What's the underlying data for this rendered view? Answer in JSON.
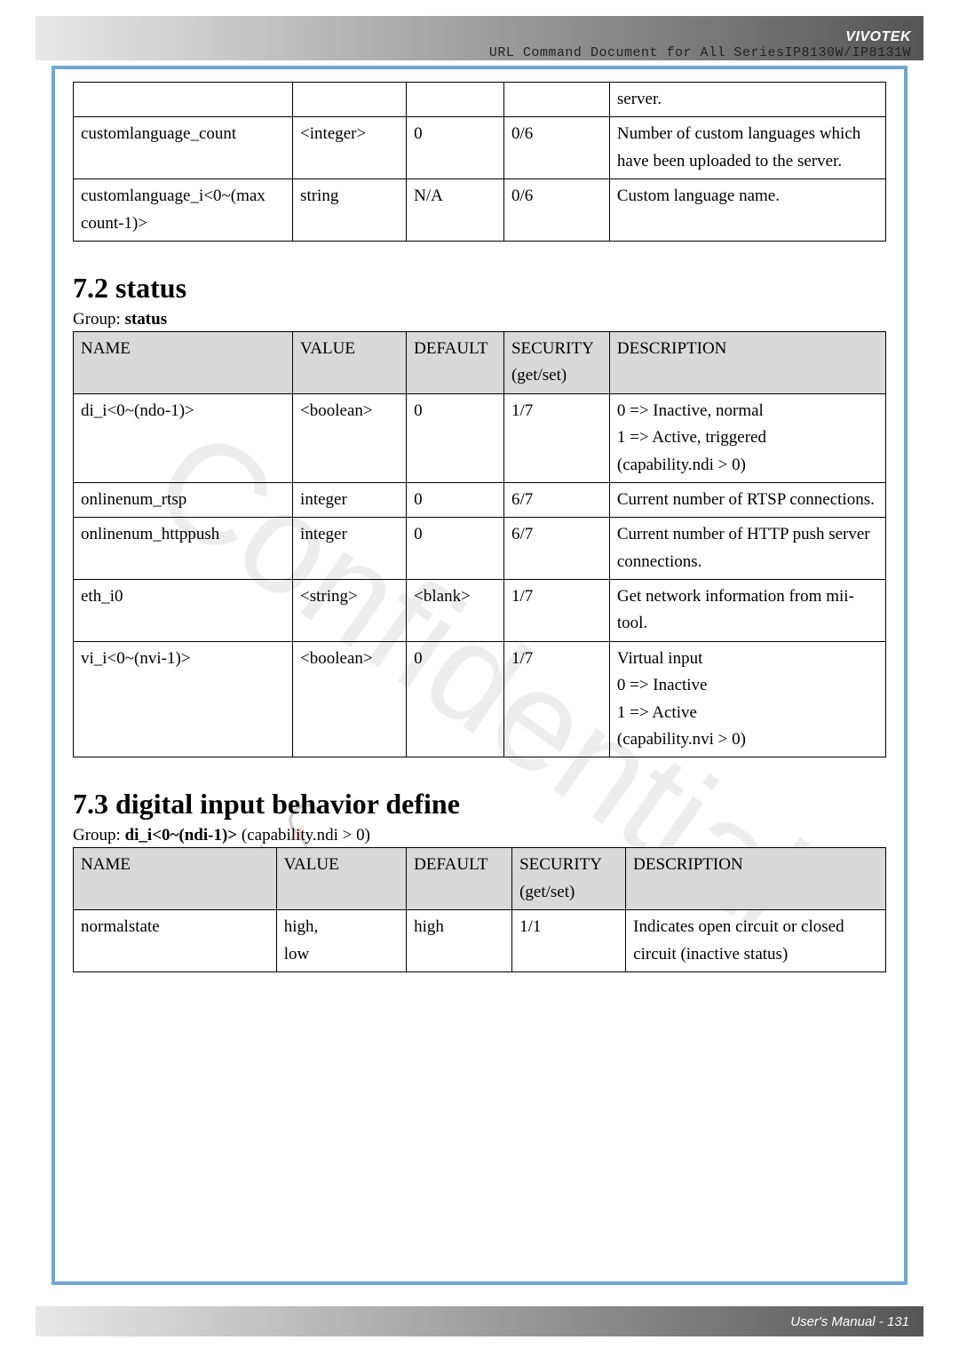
{
  "header": {
    "brand": "VIVOTEK",
    "subtitle": "URL Command Document for All SeriesIP8130W/IP8131W"
  },
  "watermark": "Confidential",
  "table1": {
    "rows": [
      {
        "name": "",
        "value": "",
        "def": "",
        "sec": "",
        "desc": "server."
      },
      {
        "name": "customlanguage_count",
        "value": "<integer>",
        "def": "0",
        "sec": "0/6",
        "desc": "Number of custom languages which have been uploaded to the server."
      },
      {
        "name": "customlanguage_i<0~(max count-1)>",
        "value": "string",
        "def": "N/A",
        "sec": "0/6",
        "desc": "Custom language name."
      }
    ]
  },
  "section72": {
    "heading": "7.2 status",
    "group_label": "Group:",
    "group_value": "status",
    "headers": {
      "name": "NAME",
      "value": "VALUE",
      "def": "DEFAULT",
      "sec": "SECURITY (get/set)",
      "desc": "DESCRIPTION"
    },
    "rows": [
      {
        "name": "di_i<0~(ndo-1)>",
        "value": "<boolean>",
        "def": "0",
        "sec": "1/7",
        "desc": "0 => Inactive, normal\n1 => Active, triggered\n(capability.ndi > 0)"
      },
      {
        "name": "onlinenum_rtsp",
        "value": "integer",
        "def": "0",
        "sec": "6/7",
        "desc": "Current number of RTSP connections."
      },
      {
        "name": "onlinenum_httppush",
        "value": "integer",
        "def": "0",
        "sec": "6/7",
        "desc": "Current number of HTTP push server connections."
      },
      {
        "name": "eth_i0",
        "value": "<string>",
        "def": "<blank>",
        "sec": "1/7",
        "desc": "Get network information from mii-tool."
      },
      {
        "name": "vi_i<0~(nvi-1)>",
        "value": "<boolean>",
        "def": "0",
        "sec": "1/7",
        "desc": "Virtual input\n0 => Inactive\n1 => Active\n(capability.nvi > 0)"
      }
    ]
  },
  "section73": {
    "heading": "7.3 digital input behavior define",
    "group_prefix": "Group: ",
    "group_bold": "di_i<0~(ndi-1)>",
    "group_suffix": " (capability.ndi > 0)",
    "headers": {
      "name": "NAME",
      "value": "VALUE",
      "def": "DEFAULT",
      "sec": "SECURITY (get/set)",
      "desc": "DESCRIPTION"
    },
    "rows": [
      {
        "name": "normalstate",
        "value": "high,\nlow",
        "def": "high",
        "sec": "1/1",
        "desc": "Indicates open circuit or closed circuit (inactive status)"
      }
    ]
  },
  "footer": {
    "text": "User's Manual - 131"
  }
}
